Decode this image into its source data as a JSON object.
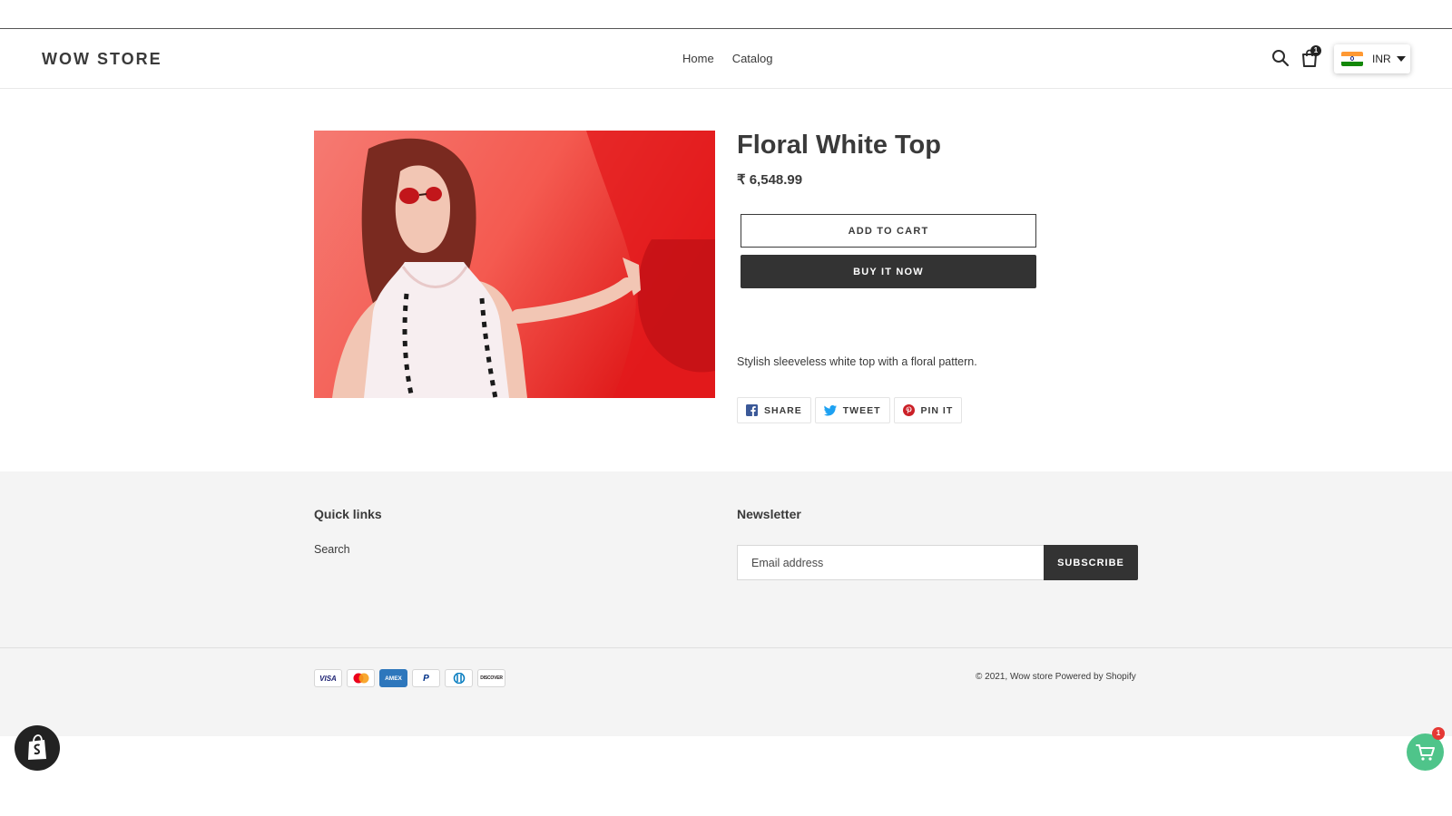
{
  "header": {
    "logo": "WOW STORE",
    "nav": [
      "Home",
      "Catalog"
    ],
    "cart_count": "1",
    "currency": "INR"
  },
  "product": {
    "title": "Floral White Top",
    "price": "₹ 6,548.99",
    "add_to_cart": "ADD TO CART",
    "buy_now": "BUY IT NOW",
    "description": "Stylish sleeveless white top with a floral pattern.",
    "share": {
      "facebook": "SHARE",
      "twitter": "TWEET",
      "pinterest": "PIN IT"
    }
  },
  "footer": {
    "quick_links_title": "Quick links",
    "quick_links": [
      "Search"
    ],
    "newsletter_title": "Newsletter",
    "email_placeholder": "Email address",
    "subscribe": "SUBSCRIBE",
    "payment_methods": [
      "VISA",
      "mastercard",
      "AMEX",
      "PayPal",
      "Diners",
      "DISCOVER"
    ],
    "copyright": "© 2021, Wow store Powered by Shopify"
  },
  "floating": {
    "cart_badge": "1"
  },
  "colors": {
    "dark_button": "#333333",
    "footer_bg": "#f4f4f4",
    "cart_fab": "#4fc48a",
    "badge_red": "#e53935"
  }
}
